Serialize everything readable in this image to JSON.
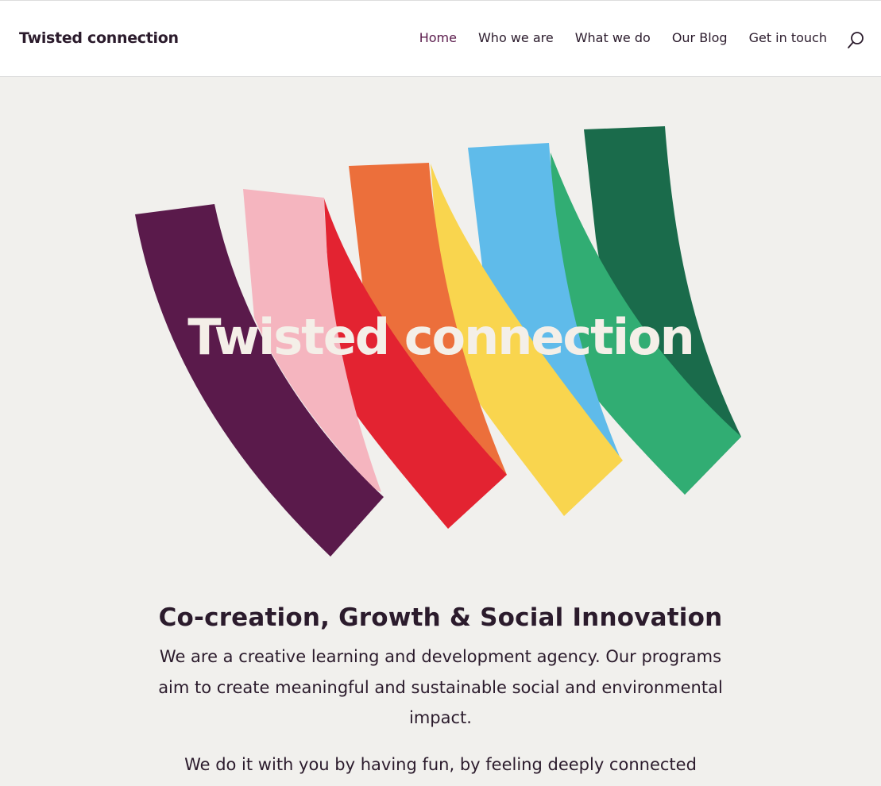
{
  "site": {
    "logo": "Twisted connection"
  },
  "nav": {
    "items": [
      {
        "label": "Home"
      },
      {
        "label": "Who we are"
      },
      {
        "label": "What we do"
      },
      {
        "label": "Our Blog"
      },
      {
        "label": "Get in touch"
      }
    ],
    "active_color": "#5a1a4b"
  },
  "search": {
    "icon": "search-icon"
  },
  "hero": {
    "title": "Twisted connection",
    "ribbon_colors": [
      "#5a1a4b",
      "#f5b5bf",
      "#e32331",
      "#ec6f3b",
      "#f9d54e",
      "#5fbbea",
      "#31ad73",
      "#1a6b4b"
    ]
  },
  "intro": {
    "heading": "Co-creation, Growth & Social Innovation",
    "paragraph1": "We are a creative learning and development agency. Our programs aim to create meaningful and sustainable social and environmental impact.",
    "paragraph2": "We do it with you by having fun, by feeling deeply connected"
  },
  "colors": {
    "background": "#f1f0ed",
    "text": "#2b1b2c",
    "header_bg": "#ffffff"
  }
}
